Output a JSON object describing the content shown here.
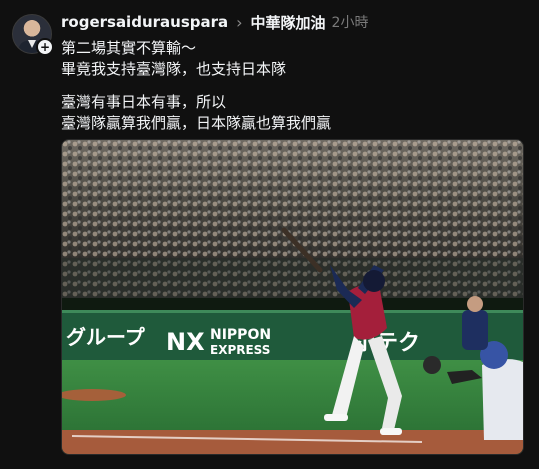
{
  "post": {
    "username": "rogersaidurauspara",
    "tag": "中華隊加油",
    "time": "2小時",
    "lines": [
      "第二場其實不算輸～",
      "畢竟我支持臺灣隊，也支持日本隊",
      "臺灣有事日本有事，所以",
      "臺灣隊贏算我們贏，日本隊贏也算我們贏"
    ]
  },
  "icons": {
    "follow": "plus-icon",
    "chevron": "chevron-right-icon"
  },
  "photo": {
    "ads": {
      "left": "グループ",
      "center_logo": "NX",
      "center_line1": "NIPPON",
      "center_line2": "EXPRESS",
      "right": "ボテク"
    }
  },
  "colors": {
    "background": "#101010",
    "text": "#f3f5f7",
    "muted": "#7a7a7a",
    "field": "#2e7d3a",
    "wall": "#1f5a3b"
  }
}
